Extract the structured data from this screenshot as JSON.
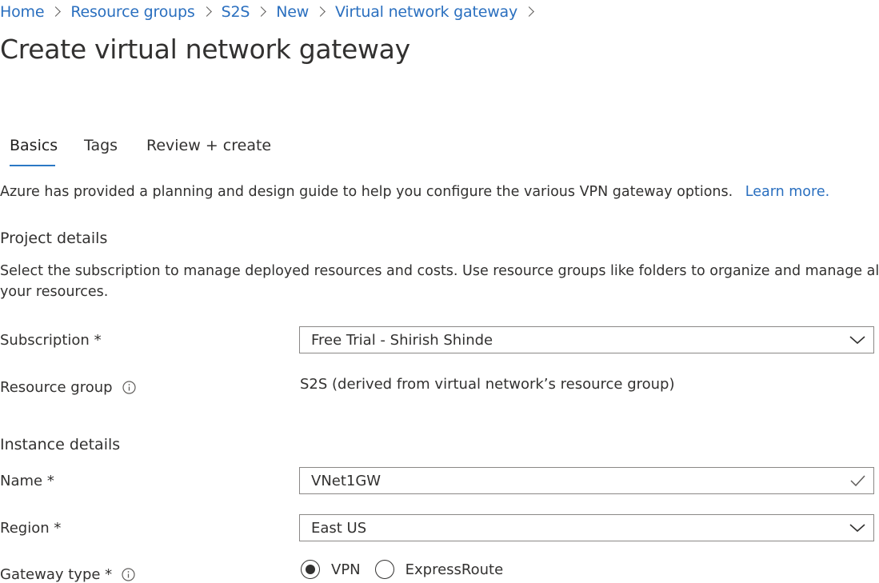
{
  "breadcrumb": [
    "Home",
    "Resource groups",
    "S2S",
    "New",
    "Virtual network gateway"
  ],
  "page_title": "Create virtual network gateway",
  "tabs": [
    {
      "label": "Basics",
      "active": true
    },
    {
      "label": "Tags",
      "active": false
    },
    {
      "label": "Review + create",
      "active": false
    }
  ],
  "intro": {
    "text": "Azure has provided a planning and design guide to help you configure the various VPN gateway options.",
    "link": "Learn more."
  },
  "project_details": {
    "heading": "Project details",
    "description_line1": "Select the subscription to manage deployed resources and costs. Use resource groups like folders to organize and manage all",
    "description_line2": "your resources.",
    "subscription_label": "Subscription *",
    "subscription_value": "Free Trial - Shirish Shinde",
    "resource_group_label": "Resource group",
    "resource_group_value": "S2S (derived from virtual network’s resource group)"
  },
  "instance_details": {
    "heading": "Instance details",
    "name_label": "Name *",
    "name_value": "VNet1GW",
    "region_label": "Region *",
    "region_value": "East US",
    "gateway_type_label": "Gateway type *",
    "gateway_type_options": [
      "VPN",
      "ExpressRoute"
    ],
    "gateway_type_selected": "VPN"
  },
  "colors": {
    "link": "#2a6fbf",
    "tab_underline": "#2b78c5",
    "text": "#323130",
    "border": "#8a8886"
  }
}
